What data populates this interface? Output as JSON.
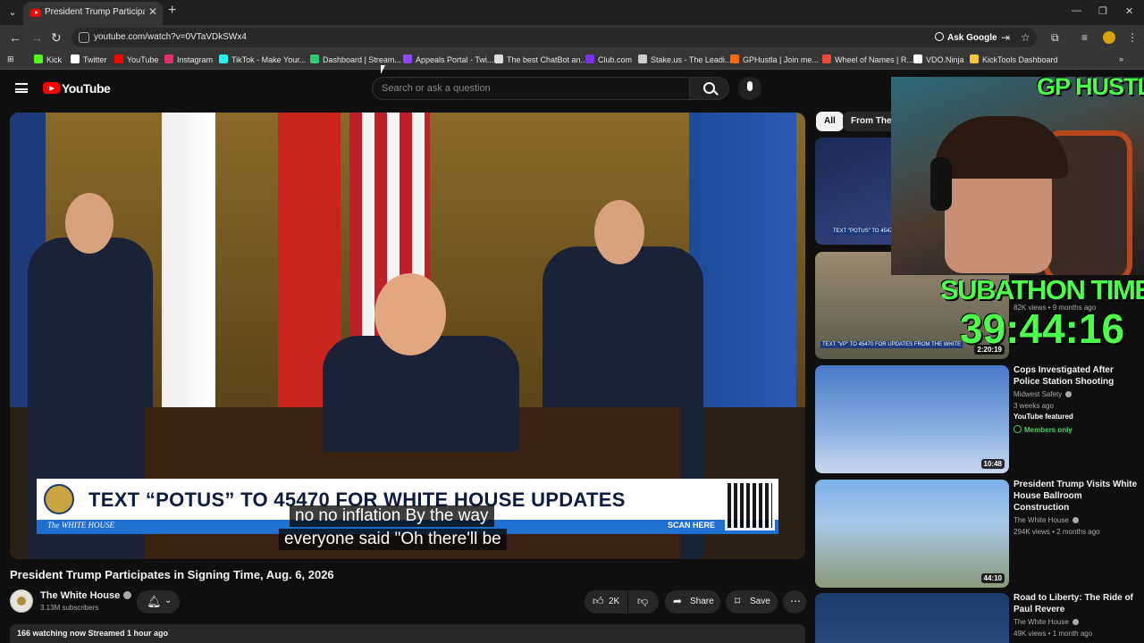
{
  "browser": {
    "tab_title": "President Trump Participates in",
    "url": "youtube.com/watch?v=0VTaVDkSWx4",
    "ask_google": "Ask Google",
    "bookmarks": [
      {
        "label": "Kick",
        "color": "#53fc18"
      },
      {
        "label": "Twitter",
        "color": "#ffffff"
      },
      {
        "label": "YouTube",
        "color": "#ff0000"
      },
      {
        "label": "Instagram",
        "color": "#e1306c"
      },
      {
        "label": "TikTok - Make Your...",
        "color": "#25f4ee"
      },
      {
        "label": "Dashboard | Stream...",
        "color": "#2ecc71"
      },
      {
        "label": "Appeals Portal - Twi...",
        "color": "#9146ff"
      },
      {
        "label": "The best ChatBot an...",
        "color": "#dddddd"
      },
      {
        "label": "Club.com",
        "color": "#7b2ff7"
      },
      {
        "label": "Stake.us - The Leadi...",
        "color": "#cccccc"
      },
      {
        "label": "GPHustla | Join me...",
        "color": "#ff6a00"
      },
      {
        "label": "Wheel of Names | R...",
        "color": "#e84c3d"
      },
      {
        "label": "VDO.Ninja",
        "color": "#ffffff"
      },
      {
        "label": "KickTools Dashboard",
        "color": "#f5c542"
      }
    ]
  },
  "youtube": {
    "logo_text": "YouTube",
    "search_placeholder": "Search or ask a question",
    "chips": [
      "All",
      "From The W"
    ]
  },
  "video": {
    "banner_text": "TEXT “POTUS” TO 45470 FOR WHITE HOUSE UPDATES",
    "banner_brand": "The WHITE HOUSE",
    "banner_scan": "SCAN HERE",
    "caption_line1": "no no inflation By the way",
    "caption_line2": "everyone said \"Oh there'll be",
    "title": "President Trump Participates in Signing Time, Aug. 6, 2026",
    "channel": "The White House",
    "subscribers": "3.13M subscribers",
    "likes": "2K",
    "share": "Share",
    "save": "Save",
    "meta": "166 watching now  Streamed 1 hour ago"
  },
  "recommendations": [
    {
      "thumb_text": "TEXT \"POTUS\" TO 4547",
      "duration": ""
    },
    {
      "thumb_text": "TEXT \"VP\" TO 45470 FOR UPDATES FROM THE WHITE",
      "views": "82K views • 9 months ago",
      "duration": "2:20:19"
    },
    {
      "title": "Cops Investigated After Police Station Shooting",
      "channel": "Midwest Safety",
      "age": "3 weeks ago",
      "featured": "YouTube featured",
      "members": "Members only",
      "duration": "10:48"
    },
    {
      "title": "President Trump Visits White House Ballroom Construction",
      "channel": "The White House",
      "views": "294K views • 2 months ago",
      "duration": "44:10"
    },
    {
      "title": "Road to Liberty: The Ride of Paul Revere",
      "channel": "The White House",
      "views": "49K views • 1 month ago"
    }
  ],
  "overlay": {
    "streamer": "GP HUSTLA",
    "subathon_label": "SUBATHON TIMER",
    "timer": "39:44:16"
  }
}
